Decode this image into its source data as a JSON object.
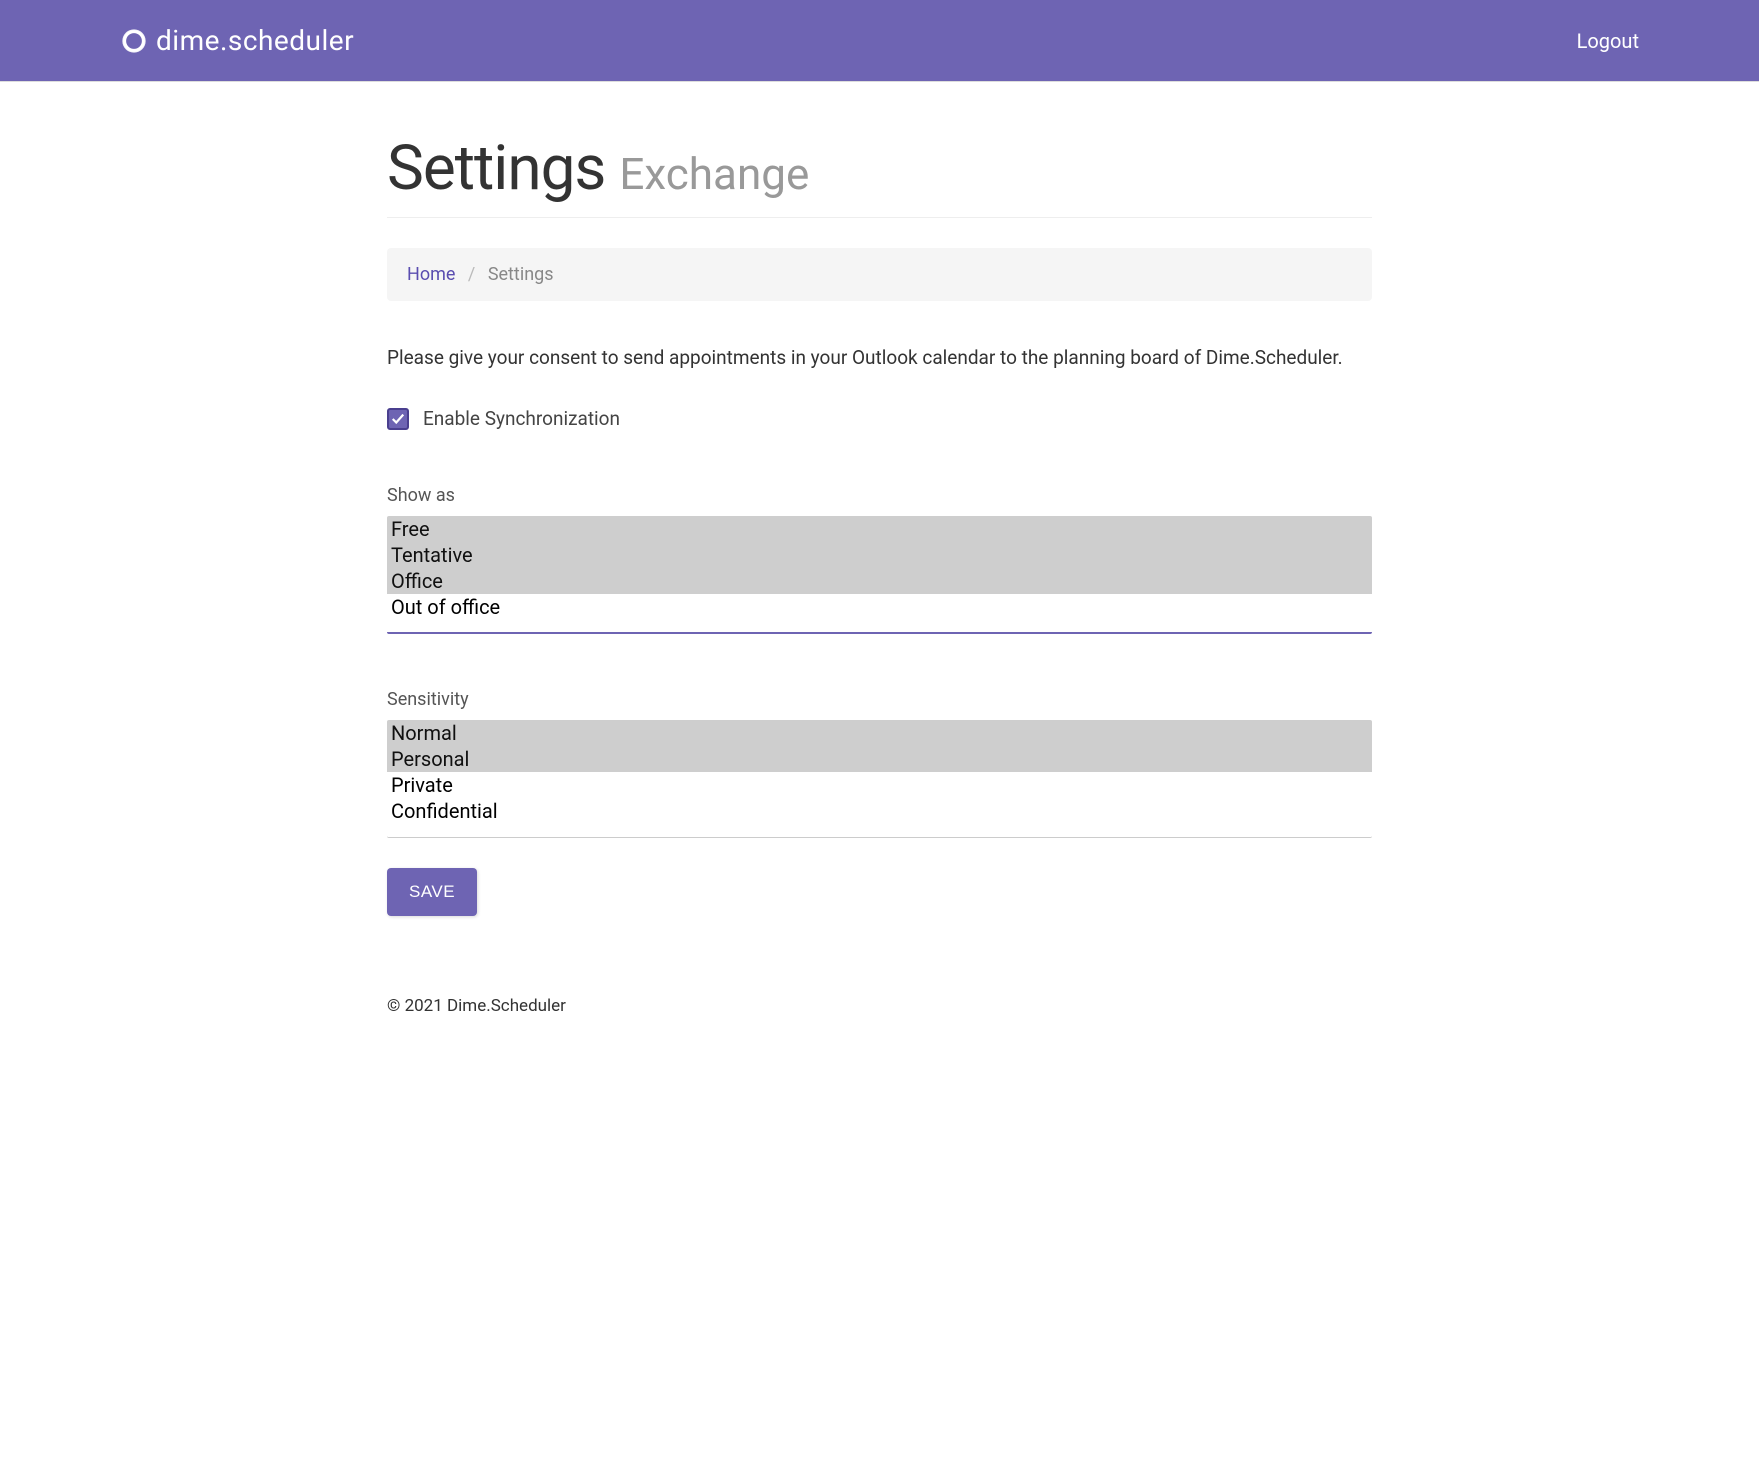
{
  "navbar": {
    "brand": "dime.scheduler",
    "logout": "Logout"
  },
  "page": {
    "title": "Settings",
    "subtitle": "Exchange"
  },
  "breadcrumb": {
    "home": "Home",
    "current": "Settings"
  },
  "description": "Please give your consent to send appointments in your Outlook calendar to the planning board of Dime.Scheduler.",
  "checkbox": {
    "label": "Enable Synchronization",
    "checked": true
  },
  "show_as": {
    "label": "Show as",
    "options": [
      "Free",
      "Tentative",
      "Office",
      "Out of office"
    ],
    "selected": [
      "Free",
      "Tentative",
      "Office"
    ]
  },
  "sensitivity": {
    "label": "Sensitivity",
    "options": [
      "Normal",
      "Personal",
      "Private",
      "Confidential"
    ],
    "selected": [
      "Normal",
      "Personal"
    ]
  },
  "save_button": "SAVE",
  "footer": "© 2021 Dime.Scheduler"
}
